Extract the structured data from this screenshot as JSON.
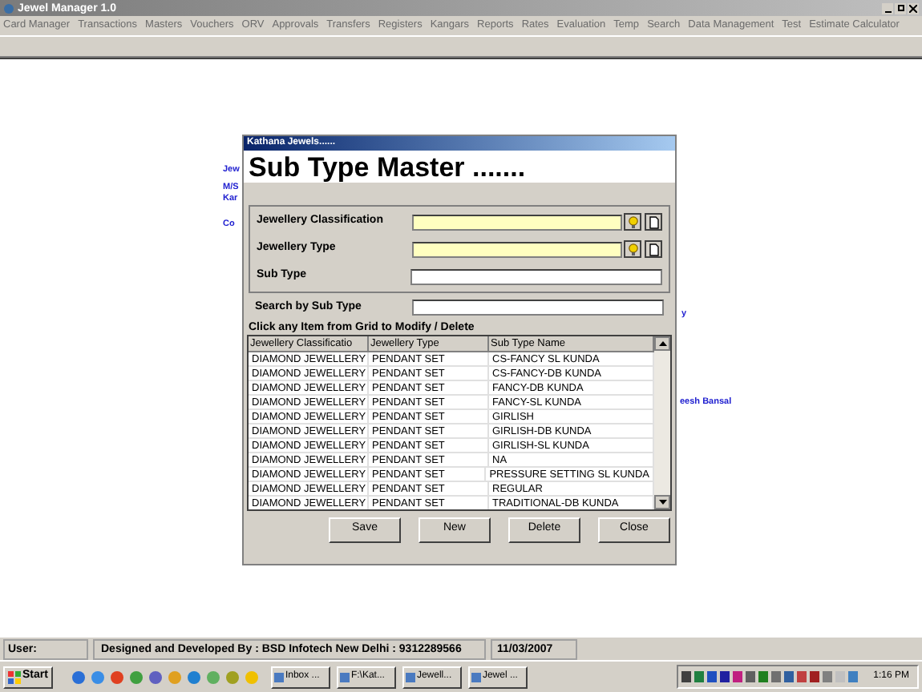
{
  "window": {
    "title": "Jewel Manager 1.0"
  },
  "menu": [
    "Card Manager",
    "Transactions",
    "Masters",
    "Vouchers",
    "ORV",
    "Approvals",
    "Transfers",
    "Registers",
    "Kangars",
    "Reports",
    "Rates",
    "Evaluation",
    "Temp",
    "Search",
    "Data Management",
    "Test",
    "Estimate Calculator"
  ],
  "background_texts": [
    "Jew",
    "M/S",
    "Kar",
    "Co",
    "y",
    "eesh Bansal"
  ],
  "dialog": {
    "caption": "Kathana Jewels......",
    "heading": "Sub Type Master .......",
    "fields": [
      {
        "label": "Jewellery Classification",
        "kind": "lookup"
      },
      {
        "label": "Jewellery Type",
        "kind": "lookup"
      },
      {
        "label": "Sub Type",
        "kind": "text"
      }
    ],
    "search": {
      "label": "Search by Sub Type"
    },
    "instruction": "Click any Item from Grid to Modify / Delete",
    "grid": {
      "columns": [
        "Jewellery Classificatio",
        "Jewellery Type",
        "Sub Type Name"
      ],
      "rows": [
        [
          "DIAMOND JEWELLERY",
          "PENDANT SET",
          "CS-FANCY SL KUNDA"
        ],
        [
          "DIAMOND JEWELLERY",
          "PENDANT SET",
          "CS-FANCY-DB KUNDA"
        ],
        [
          "DIAMOND JEWELLERY",
          "PENDANT SET",
          "FANCY-DB KUNDA"
        ],
        [
          "DIAMOND JEWELLERY",
          "PENDANT SET",
          "FANCY-SL KUNDA"
        ],
        [
          "DIAMOND JEWELLERY",
          "PENDANT SET",
          "GIRLISH"
        ],
        [
          "DIAMOND JEWELLERY",
          "PENDANT SET",
          "GIRLISH-DB KUNDA"
        ],
        [
          "DIAMOND JEWELLERY",
          "PENDANT SET",
          "GIRLISH-SL KUNDA"
        ],
        [
          "DIAMOND JEWELLERY",
          "PENDANT SET",
          "NA"
        ],
        [
          "DIAMOND JEWELLERY",
          "PENDANT SET",
          "PRESSURE SETTING SL KUNDA"
        ],
        [
          "DIAMOND JEWELLERY",
          "PENDANT SET",
          "REGULAR"
        ],
        [
          "DIAMOND JEWELLERY",
          "PENDANT SET",
          "TRADITIONAL-DB KUNDA"
        ]
      ]
    },
    "buttons": [
      {
        "label": "Save"
      },
      {
        "label": "New"
      },
      {
        "label": "Delete"
      },
      {
        "label": "Close"
      }
    ]
  },
  "status_bar": {
    "user": "User:",
    "credit": "Designed and Developed By : BSD Infotech New Delhi : 9312289566",
    "date": "11/03/2007"
  },
  "taskbar": {
    "start": "Start",
    "tasks": [
      "Inbox ...",
      "F:\\Kat...",
      "Jewell...",
      "Jewel ..."
    ],
    "clock": "1:16 PM"
  }
}
